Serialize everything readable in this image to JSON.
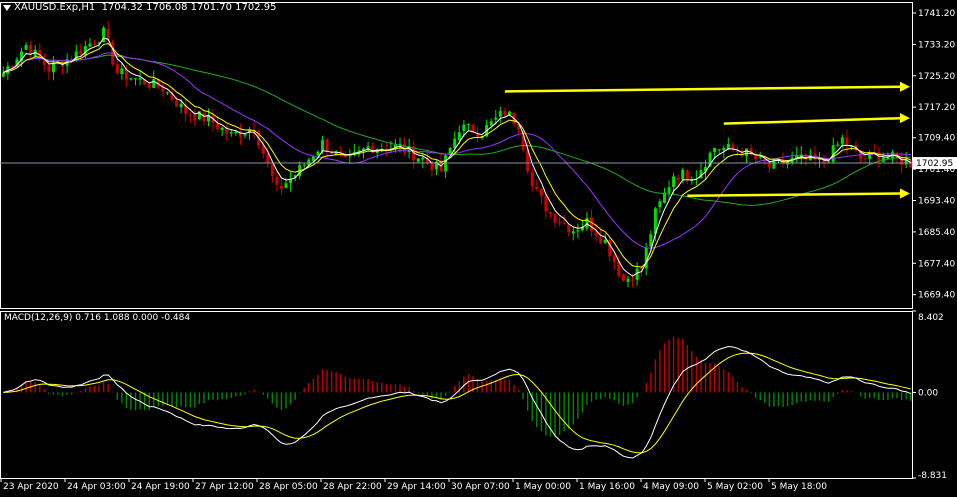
{
  "header": {
    "symbol": "XAUUSD.Exp,H1",
    "ohlc": "1704.32 1706.08 1701.70 1702.95",
    "macd_label": "MACD(12,26,9) 0.716 1.088 0.000 -0.484"
  },
  "colors": {
    "background": "#000000",
    "grid": "#FFFFFF",
    "bull_candle": "#00E000",
    "bear_candle": "#D00000",
    "ma_white": "#FFFFFF",
    "ma_yellow": "#FFFF00",
    "ma_violet": "#9933FF",
    "ma_green": "#22AA22",
    "trendline": "#FFFF00",
    "macd_line": "#FFFFFF",
    "signal_line": "#FFFF00",
    "hist_pos": "#C00000",
    "hist_neg": "#008800",
    "current_line": "#8899AA",
    "price_marker": "#FFFFFF"
  },
  "chart_data": [
    {
      "type": "candlestick",
      "title": "XAUUSD.Exp,H1",
      "ylim": [
        1666.0,
        1744.0
      ],
      "y_ticks": [
        "1741.20",
        "1733.20",
        "1725.20",
        "1717.20",
        "1709.40",
        "1701.40",
        "1693.40",
        "1685.40",
        "1677.40",
        "1669.40"
      ],
      "current_price": "1702.95",
      "x_labels": [
        "23 Apr 2020",
        "24 Apr 03:00",
        "24 Apr 19:00",
        "27 Apr 12:00",
        "28 Apr 05:00",
        "28 Apr 22:00",
        "29 Apr 14:00",
        "30 Apr 07:00",
        "1 May 00:00",
        "1 May 16:00",
        "4 May 09:00",
        "5 May 02:00",
        "5 May 18:00"
      ],
      "bars": 200,
      "price_anchors": [
        [
          0,
          1726
        ],
        [
          5,
          1733
        ],
        [
          10,
          1727
        ],
        [
          15,
          1730
        ],
        [
          22,
          1736
        ],
        [
          25,
          1726
        ],
        [
          30,
          1724
        ],
        [
          35,
          1722
        ],
        [
          40,
          1716
        ],
        [
          45,
          1714
        ],
        [
          50,
          1710
        ],
        [
          55,
          1712
        ],
        [
          60,
          1696
        ],
        [
          64,
          1700
        ],
        [
          70,
          1708
        ],
        [
          75,
          1703
        ],
        [
          80,
          1707
        ],
        [
          87,
          1707
        ],
        [
          92,
          1704
        ],
        [
          96,
          1701
        ],
        [
          100,
          1712
        ],
        [
          105,
          1711
        ],
        [
          110,
          1716
        ],
        [
          113,
          1713
        ],
        [
          116,
          1697
        ],
        [
          120,
          1690
        ],
        [
          125,
          1686
        ],
        [
          128,
          1688
        ],
        [
          132,
          1683
        ],
        [
          136,
          1673
        ],
        [
          140,
          1676
        ],
        [
          143,
          1690
        ],
        [
          147,
          1700
        ],
        [
          152,
          1700
        ],
        [
          156,
          1707
        ],
        [
          162,
          1706
        ],
        [
          168,
          1702
        ],
        [
          174,
          1704
        ],
        [
          180,
          1703
        ],
        [
          184,
          1709
        ],
        [
          188,
          1704
        ],
        [
          192,
          1705
        ],
        [
          199,
          1703
        ]
      ],
      "trendlines": [
        {
          "start_bar": 110,
          "start_price": 1721.2,
          "end_price": 1722.4
        },
        {
          "start_bar": 158,
          "start_price": 1713.0,
          "end_price": 1714.4
        },
        {
          "start_bar": 150,
          "start_price": 1694.6,
          "end_price": 1695.2
        }
      ]
    },
    {
      "type": "macd",
      "title": "MACD(12,26,9) 0.716 1.088 0.000 -0.484",
      "ylim": [
        -8.831,
        8.402
      ],
      "y_ticks": [
        "8.402",
        "0.00",
        "-8.831"
      ],
      "params": [
        12,
        26,
        9
      ],
      "values": {
        "macd": 0.716,
        "signal": 1.088,
        "third": 0.0,
        "fourth": -0.484
      }
    }
  ]
}
